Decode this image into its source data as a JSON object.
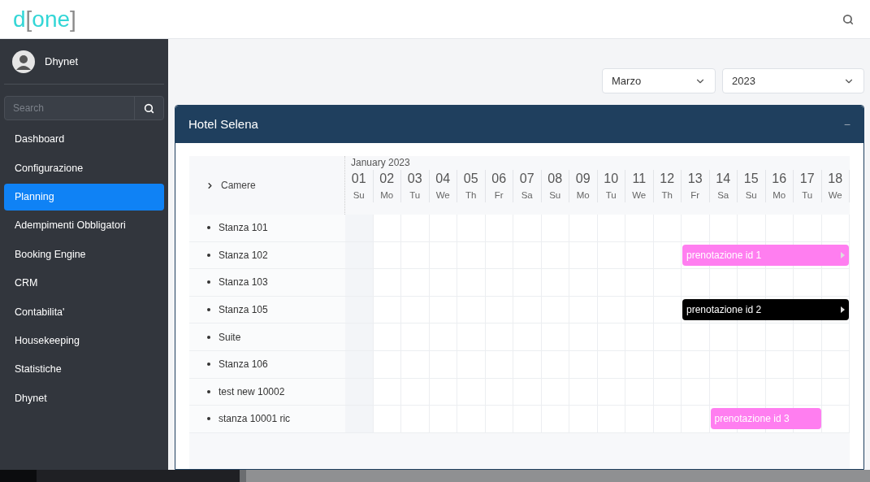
{
  "header": {
    "logo": {
      "letter": "d",
      "open_bracket": "[",
      "word": "one",
      "close_bracket": "]"
    }
  },
  "sidebar": {
    "user": {
      "name": "Dhynet"
    },
    "search": {
      "placeholder": "Search"
    },
    "items": [
      {
        "label": "Dashboard",
        "selected": false
      },
      {
        "label": "Configurazione",
        "selected": false
      },
      {
        "label": "Planning",
        "selected": true
      },
      {
        "label": "Adempimenti Obbligatori",
        "selected": false
      },
      {
        "label": "Booking Engine",
        "selected": false
      },
      {
        "label": "CRM",
        "selected": false
      },
      {
        "label": "Contabilita'",
        "selected": false
      },
      {
        "label": "Housekeeping",
        "selected": false
      },
      {
        "label": "Statistiche",
        "selected": false
      },
      {
        "label": "Dhynet",
        "selected": false
      }
    ]
  },
  "filters": {
    "month": "Marzo",
    "year": "2023"
  },
  "panel": {
    "title": "Hotel Selena",
    "toggle": "−",
    "planner": {
      "resource_heading": "Camere",
      "month_label": "January 2023",
      "days": [
        {
          "num": "01",
          "dow": "Su"
        },
        {
          "num": "02",
          "dow": "Mo"
        },
        {
          "num": "03",
          "dow": "Tu"
        },
        {
          "num": "04",
          "dow": "We"
        },
        {
          "num": "05",
          "dow": "Th"
        },
        {
          "num": "06",
          "dow": "Fr"
        },
        {
          "num": "07",
          "dow": "Sa"
        },
        {
          "num": "08",
          "dow": "Su"
        },
        {
          "num": "09",
          "dow": "Mo"
        },
        {
          "num": "10",
          "dow": "Tu"
        },
        {
          "num": "11",
          "dow": "We"
        },
        {
          "num": "12",
          "dow": "Th"
        },
        {
          "num": "13",
          "dow": "Fr"
        },
        {
          "num": "14",
          "dow": "Sa"
        },
        {
          "num": "15",
          "dow": "Su"
        },
        {
          "num": "16",
          "dow": "Mo"
        },
        {
          "num": "17",
          "dow": "Tu"
        },
        {
          "num": "18",
          "dow": "We"
        }
      ],
      "rooms": [
        {
          "name": "Stanza 101"
        },
        {
          "name": "Stanza 102",
          "bookings": [
            {
              "label": "prenotazione id 1",
              "color": "#ff7ef0",
              "continues": true
            }
          ]
        },
        {
          "name": "Stanza 103"
        },
        {
          "name": "Stanza 105",
          "bookings": [
            {
              "label": "prenotazione id 2",
              "color": "#000000",
              "continues": true
            }
          ]
        },
        {
          "name": "Suite"
        },
        {
          "name": "Stanza 106"
        },
        {
          "name": "test new 10002"
        },
        {
          "name": "stanza 10001 ric",
          "bookings": [
            {
              "label": "prenotazione id 3",
              "color": "#ff7ef0",
              "continues": false
            }
          ]
        }
      ]
    }
  }
}
